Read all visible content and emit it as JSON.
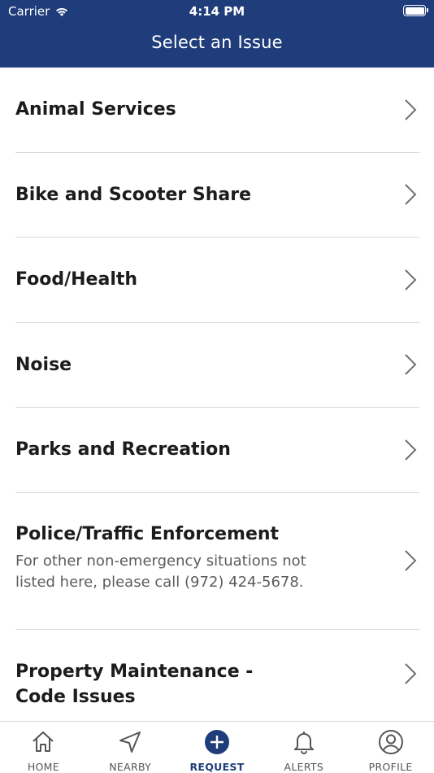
{
  "status_bar": {
    "carrier": "Carrier",
    "time": "4:14 PM",
    "battery_level": 1.0
  },
  "header": {
    "title": "Select an Issue"
  },
  "issues": [
    {
      "label": "Animal Services"
    },
    {
      "label": "Bike and Scooter Share"
    },
    {
      "label": "Food/Health"
    },
    {
      "label": "Noise"
    },
    {
      "label": "Parks and Recreation"
    },
    {
      "label": "Police/Traffic Enforcement",
      "description": "For other non-emergency situations not listed here, please call (972) 424-5678."
    },
    {
      "label": "Property Maintenance - Code Issues"
    }
  ],
  "tabs": [
    {
      "label": "HOME",
      "icon": "home-icon"
    },
    {
      "label": "NEARBY",
      "icon": "navigation-arrow-icon"
    },
    {
      "label": "REQUEST",
      "icon": "add-circle-icon",
      "active": true
    },
    {
      "label": "ALERTS",
      "icon": "bell-icon"
    },
    {
      "label": "PROFILE",
      "icon": "user-circle-icon"
    }
  ],
  "colors": {
    "header_bg": "#1f3d7a",
    "active_tab": "#1f3d7a",
    "inactive_tab": "#555555"
  }
}
